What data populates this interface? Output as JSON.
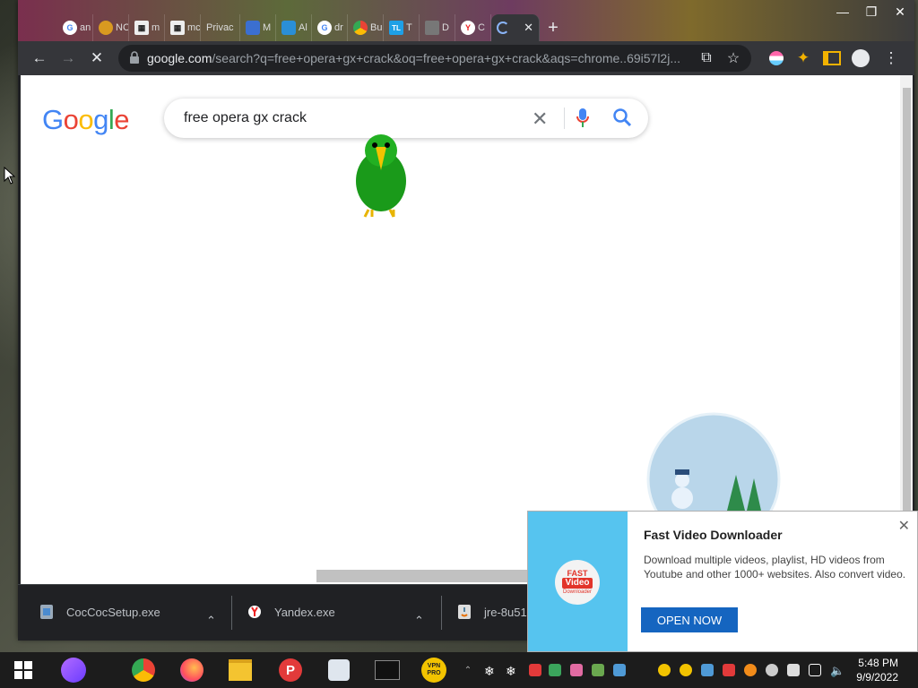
{
  "browser": {
    "tabs": [
      {
        "label": "an",
        "icon": "google-icon"
      },
      {
        "label": "NC",
        "icon": "site-icon"
      },
      {
        "label": "m",
        "icon": "bank-icon"
      },
      {
        "label": "mc",
        "icon": "bank-icon"
      },
      {
        "label": "Privac",
        "icon": "blank-icon"
      },
      {
        "label": "M",
        "icon": "shield-icon"
      },
      {
        "label": "Al",
        "icon": "puzzle-icon"
      },
      {
        "label": "dr",
        "icon": "google-icon"
      },
      {
        "label": "Bu",
        "icon": "chrome-icon"
      },
      {
        "label": "T",
        "icon": "tl-icon"
      },
      {
        "label": "D",
        "icon": "cube-icon"
      },
      {
        "label": "C",
        "icon": "yandex-icon"
      },
      {
        "label": "",
        "icon": "loading-icon",
        "active": true
      }
    ],
    "url_host": "google.com",
    "url_path": "/search?q=free+opera+gx+crack&oq=free+opera+gx+crack&aqs=chrome..69i57l2j..."
  },
  "page": {
    "logo": [
      "G",
      "o",
      "o",
      "g",
      "l",
      "e"
    ],
    "logo_colors": [
      "#4285f4",
      "#ea4335",
      "#fbbc05",
      "#4285f4",
      "#34a853",
      "#ea4335"
    ],
    "search_query": "free opera gx crack"
  },
  "downloads": [
    {
      "name": "CocCocSetup.exe",
      "icon": "installer-icon"
    },
    {
      "name": "Yandex.exe",
      "icon": "yandex-icon"
    },
    {
      "name": "jre-8u51",
      "icon": "java-icon"
    }
  ],
  "notification": {
    "badge_line1": "FAST",
    "badge_line2": "Video",
    "badge_line3": "Downloader",
    "title": "Fast Video Downloader",
    "description": "Download multiple videos, playlist, HD videos from Youtube and other 1000+ websites. Also convert video.",
    "button": "OPEN NOW"
  },
  "taskbar": {
    "time": "5:48 PM",
    "date": "9/9/2022",
    "vpn_label": "VPN PRO"
  }
}
